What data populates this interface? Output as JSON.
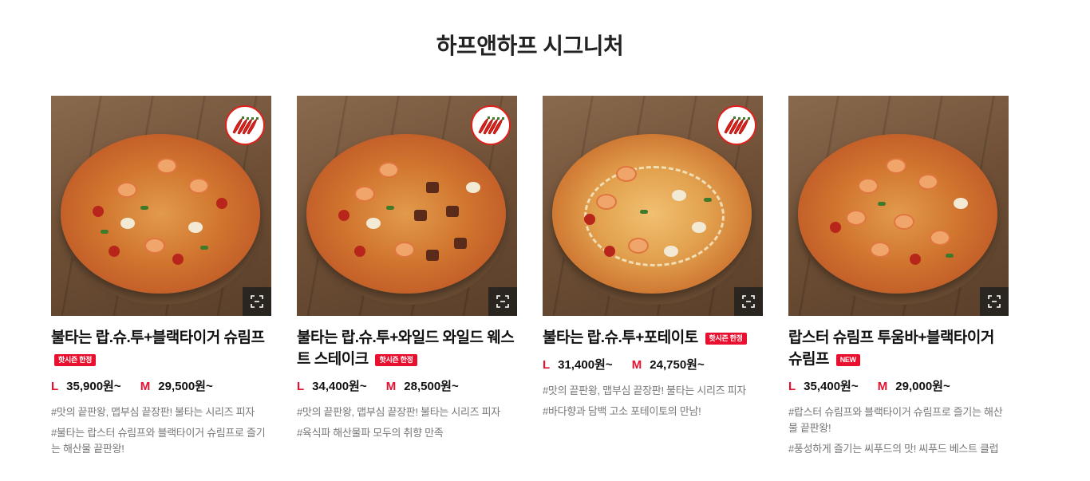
{
  "section": {
    "title": "하프앤하프 시그니처"
  },
  "products": [
    {
      "name": "불타는 랍.슈.투+블랙타이거 슈림프",
      "tag": "핫시즌 한정",
      "spicy": true,
      "prices": [
        {
          "size": "L",
          "value": "35,900원~"
        },
        {
          "size": "M",
          "value": "29,500원~"
        }
      ],
      "descriptions": [
        "#맛의 끝판왕, 맵부심 끝장판! 불타는 시리즈 피자",
        "#불타는 랍스터 슈림프와 블랙타이거 슈림프로 즐기는 해산물 끝판왕!"
      ]
    },
    {
      "name": "불타는 랍.슈.투+와일드 와일드 웨스트 스테이크",
      "tag": "핫시즌 한정",
      "spicy": true,
      "prices": [
        {
          "size": "L",
          "value": "34,400원~"
        },
        {
          "size": "M",
          "value": "28,500원~"
        }
      ],
      "descriptions": [
        "#맛의 끝판왕, 맵부심 끝장판! 불타는 시리즈 피자",
        "#육식파 해산물파 모두의 취향 만족"
      ]
    },
    {
      "name": "불타는 랍.슈.투+포테이토",
      "tag": "핫시즌 한정",
      "spicy": true,
      "prices": [
        {
          "size": "L",
          "value": "31,400원~"
        },
        {
          "size": "M",
          "value": "24,750원~"
        }
      ],
      "descriptions": [
        "#맛의 끝판왕, 맵부심 끝장판! 불타는 시리즈 피자",
        "#바다향과 담백 고소 포테이토의 만남!"
      ]
    },
    {
      "name": "랍스터 슈림프 투움바+블랙타이거 슈림프",
      "tag": "NEW",
      "spicy": false,
      "prices": [
        {
          "size": "L",
          "value": "35,400원~"
        },
        {
          "size": "M",
          "value": "29,000원~"
        }
      ],
      "descriptions": [
        "#랍스터 슈림프와 블랙타이거 슈림프로 즐기는 해산물 끝판왕!",
        "#풍성하게 즐기는 씨푸드의 맛! 씨푸드 베스트 클럽"
      ]
    }
  ],
  "colors": {
    "accent": "#e8102e",
    "desc": "#777777",
    "title": "#222222"
  },
  "icons": {
    "spicy": "chili-peppers-icon",
    "zoom": "zoom-expand-icon"
  }
}
